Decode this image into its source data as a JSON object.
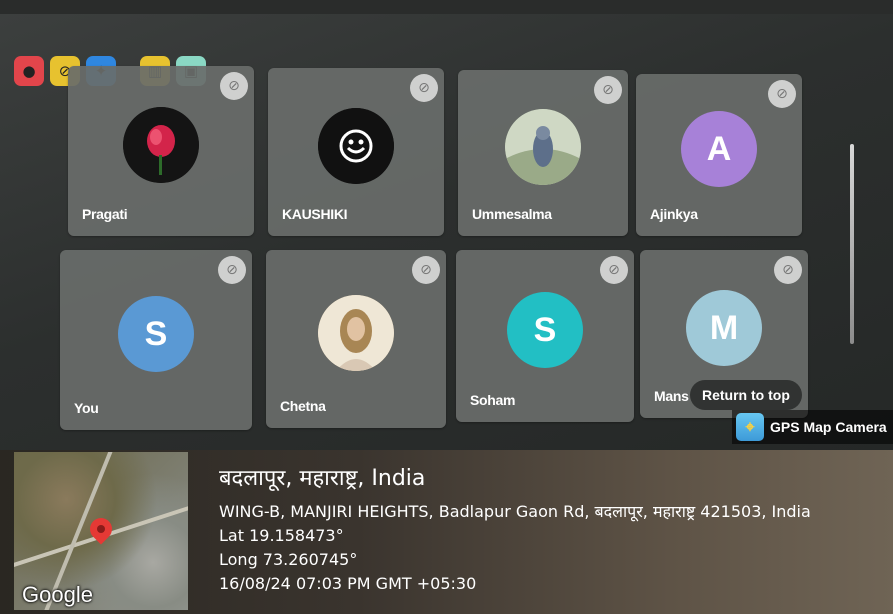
{
  "toolbar": {
    "buttons": [
      {
        "icon": "record-icon",
        "color": "#e2454b",
        "glyph": "●"
      },
      {
        "icon": "no-camera-icon",
        "color": "#e7c22f",
        "glyph": "⊘"
      },
      {
        "icon": "effects-icon",
        "color": "#2f87e0",
        "glyph": "✦"
      },
      {
        "icon": "grid-icon",
        "color": "#e7c22f",
        "glyph": "▥"
      },
      {
        "icon": "screen-share-icon",
        "color": "#8ad8c4",
        "glyph": "▣"
      }
    ]
  },
  "participants": [
    {
      "name": "Pragati",
      "initial": "",
      "avatar_color": "#1a1a1a",
      "avatar_kind": "photo-rose"
    },
    {
      "name": "KAUSHIKI",
      "initial": "",
      "avatar_color": "#111111",
      "avatar_kind": "logo"
    },
    {
      "name": "Ummesalma",
      "initial": "",
      "avatar_color": "#a9b7a0",
      "avatar_kind": "photo-outdoor"
    },
    {
      "name": "Ajinkya",
      "initial": "A",
      "avatar_color": "#a781d8",
      "avatar_kind": "letter"
    },
    {
      "name": "You",
      "initial": "S",
      "avatar_color": "#5a99d4",
      "avatar_kind": "letter"
    },
    {
      "name": "Chetna",
      "initial": "",
      "avatar_color": "#d8c3a0",
      "avatar_kind": "photo-person"
    },
    {
      "name": "Soham",
      "initial": "S",
      "avatar_color": "#22bfc4",
      "avatar_kind": "letter"
    },
    {
      "name": "Mans",
      "initial": "M",
      "avatar_color": "#9fc9d8",
      "avatar_kind": "letter"
    }
  ],
  "return_to_top": "Return to top",
  "gps_badge": "GPS Map Camera",
  "location": {
    "city": "बदलापूर, महाराष्ट्र, India",
    "address": "WING-B, MANJIRI HEIGHTS, Badlapur Gaon Rd, बदलापूर, महाराष्ट्र 421503, India",
    "lat": "Lat 19.158473°",
    "long": "Long 73.260745°",
    "datetime": "16/08/24 07:03 PM GMT +05:30"
  },
  "map": {
    "logo": "Google"
  }
}
